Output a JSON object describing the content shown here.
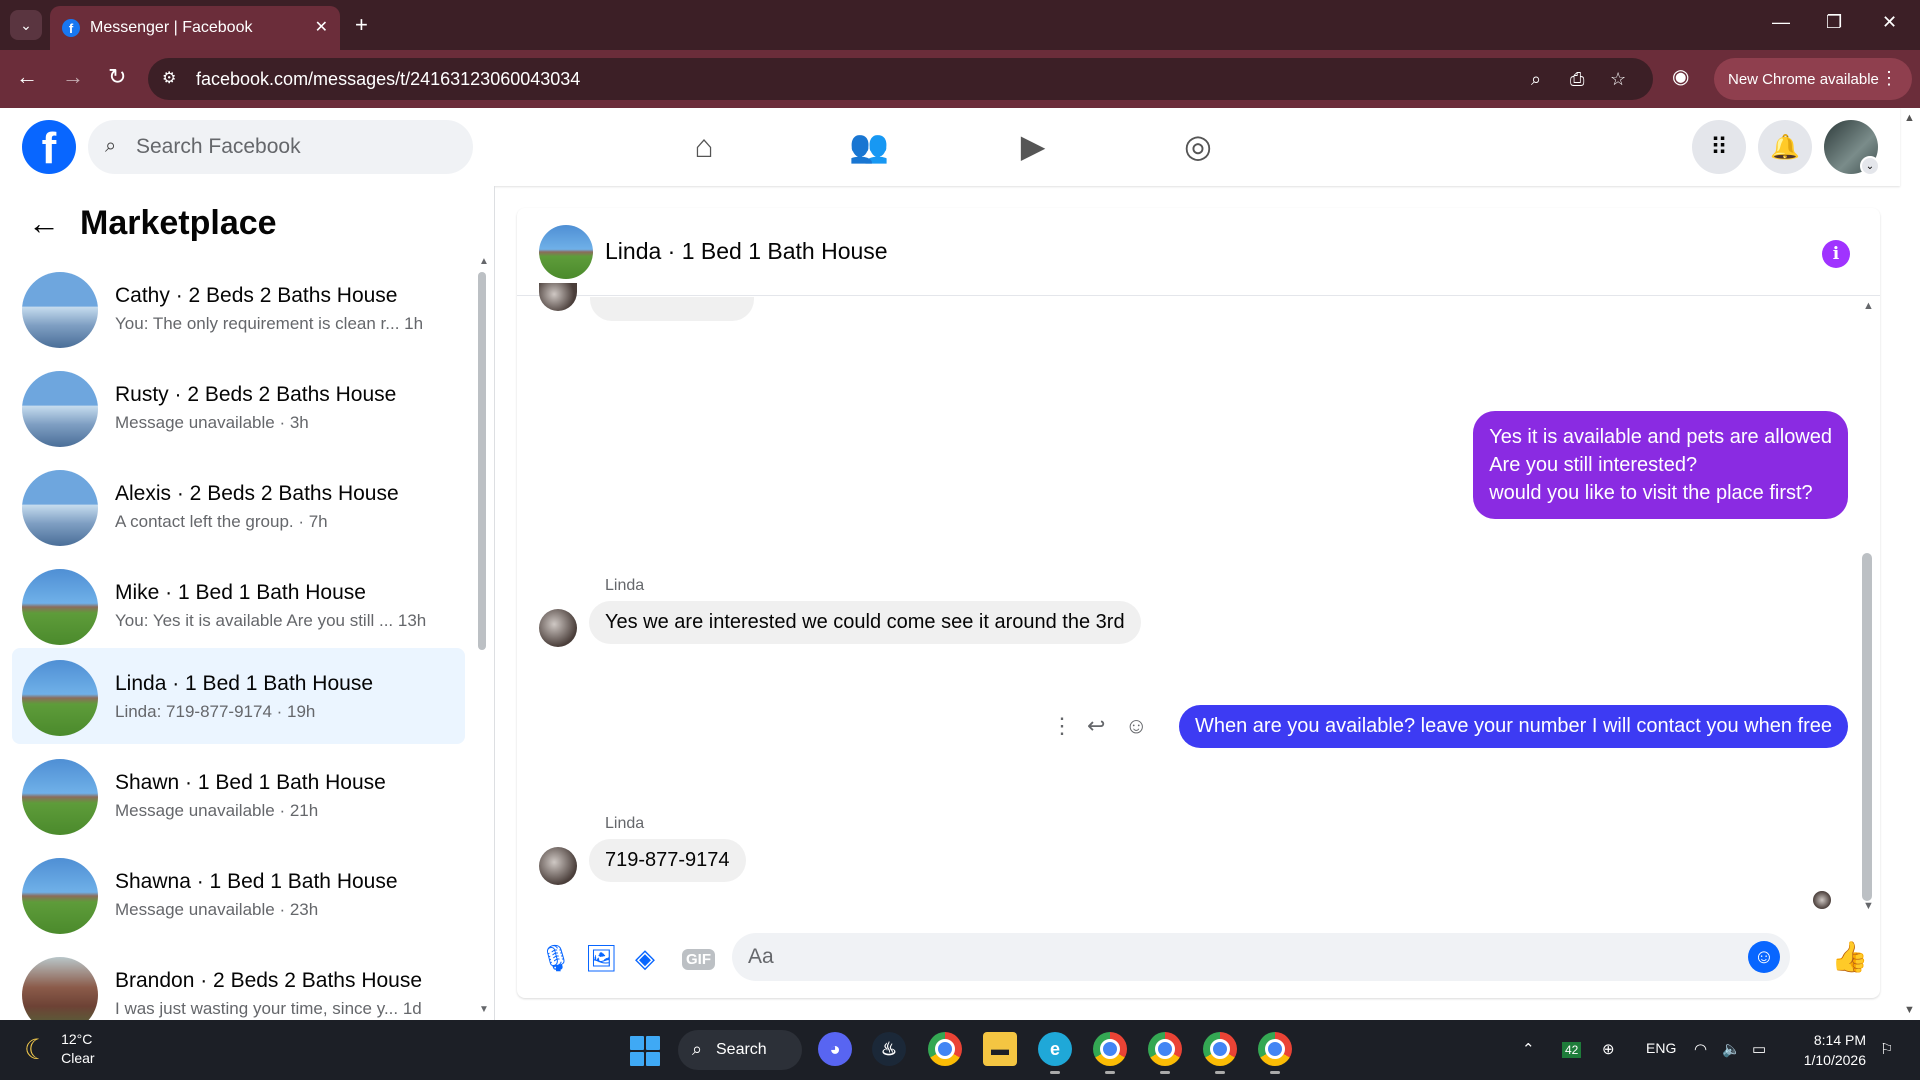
{
  "browser": {
    "tab_title": "Messenger | Facebook",
    "tab_favicon": "f",
    "url": "facebook.com/messages/t/24163123060043034",
    "new_chrome_label": "New Chrome available"
  },
  "fb_header": {
    "logo_letter": "f",
    "search_placeholder": "Search Facebook",
    "nav_icons": [
      "home-icon",
      "friends-icon",
      "video-icon",
      "groups-icon"
    ],
    "right_icons": [
      "menu-grid-icon",
      "bell-icon",
      "profile-avatar"
    ]
  },
  "sidebar": {
    "title": "Marketplace",
    "conversations": [
      {
        "name": "Cathy · 2 Beds 2 Baths House",
        "snippet": "You: The only requirement is clean r... 1h",
        "thumb": "house-blue"
      },
      {
        "name": "Rusty · 2 Beds 2 Baths House",
        "snippet": "Message unavailable · 3h",
        "thumb": "house-blue"
      },
      {
        "name": "Alexis · 2 Beds 2 Baths House",
        "snippet": "A contact left the group. · 7h",
        "thumb": "house-blue"
      },
      {
        "name": "Mike · 1 Bed 1 Bath House",
        "snippet": "You: Yes it is available Are you still ... 13h",
        "thumb": "house-field"
      },
      {
        "name": "Linda · 1 Bed 1 Bath House",
        "snippet": "Linda: 719-877-9174 · 19h",
        "thumb": "house-field",
        "active": true
      },
      {
        "name": "Shawn · 1 Bed 1 Bath House",
        "snippet": "Message unavailable · 21h",
        "thumb": "house-field"
      },
      {
        "name": "Shawna · 1 Bed 1 Bath House",
        "snippet": "Message unavailable · 23h",
        "thumb": "house-field"
      },
      {
        "name": "Brandon · 2 Beds 2 Baths House",
        "snippet": "I was just wasting your time, since y... 1d",
        "thumb": "house-brick"
      }
    ]
  },
  "chat": {
    "title": "Linda · 1 Bed 1 Bath House",
    "messages": [
      {
        "from": "me",
        "lines": [
          "Yes it is available and pets are allowed",
          "Are you still interested?",
          "would you like to visit the place first?"
        ]
      },
      {
        "from": "Linda",
        "sender_label": "Linda",
        "text": "Yes we are interested we could come see it around the 3rd"
      },
      {
        "from": "me",
        "text": "When are you available? leave your number I will contact you when free"
      },
      {
        "from": "Linda",
        "sender_label": "Linda",
        "text": "719-877-9174"
      }
    ],
    "composer_placeholder": "Aa",
    "colors": {
      "accent_purple": "#a033ff",
      "bubble_purple": "#8a2be2",
      "bubble_blue": "#3d3bf3",
      "fb_blue": "#0866ff"
    }
  },
  "taskbar": {
    "temperature": "12°C",
    "condition": "Clear",
    "search_label": "Search",
    "lang": "ENG",
    "badge": "42",
    "time": "8:14 PM",
    "date": "1/10/2026"
  }
}
